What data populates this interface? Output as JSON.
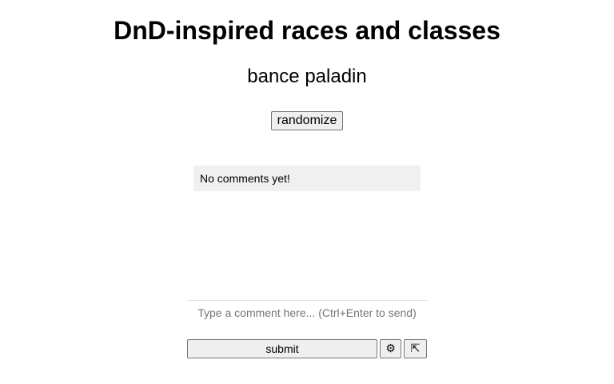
{
  "header": {
    "title": "DnD-inspired races and classes"
  },
  "generator": {
    "result": "bance paladin",
    "randomize_label": "randomize"
  },
  "comments": {
    "empty_message": "No comments yet!",
    "input_placeholder": "Type a comment here... (Ctrl+Enter to send)",
    "submit_label": "submit",
    "settings_glyph": "⚙",
    "settings_icon": "gear-icon",
    "expand_glyph": "⇱",
    "expand_icon": "expand-icon"
  }
}
